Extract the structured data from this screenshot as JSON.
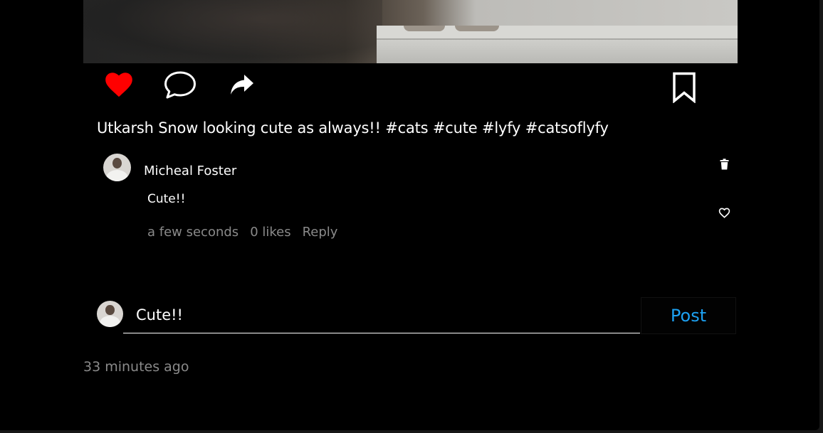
{
  "post": {
    "caption": "Utkarsh Snow looking cute as always!! #cats #cute #lyfy #catsoflyfy",
    "liked": true,
    "timestamp": "33 minutes ago"
  },
  "actions": {
    "like_icon": "heart-filled-icon",
    "comment_icon": "speech-bubble-icon",
    "share_icon": "share-arrow-icon",
    "save_icon": "bookmark-icon",
    "like_color": "#ff0000"
  },
  "comments": [
    {
      "author": "Micheal Foster",
      "text": "Cute!!",
      "time": "a few seconds",
      "likes": "0 likes",
      "reply_label": "Reply",
      "delete_icon": "trash-icon",
      "like_icon": "heart-outline-icon"
    }
  ],
  "composer": {
    "value": "Cute!!",
    "post_label": "Post",
    "post_color": "#1da1f2"
  }
}
